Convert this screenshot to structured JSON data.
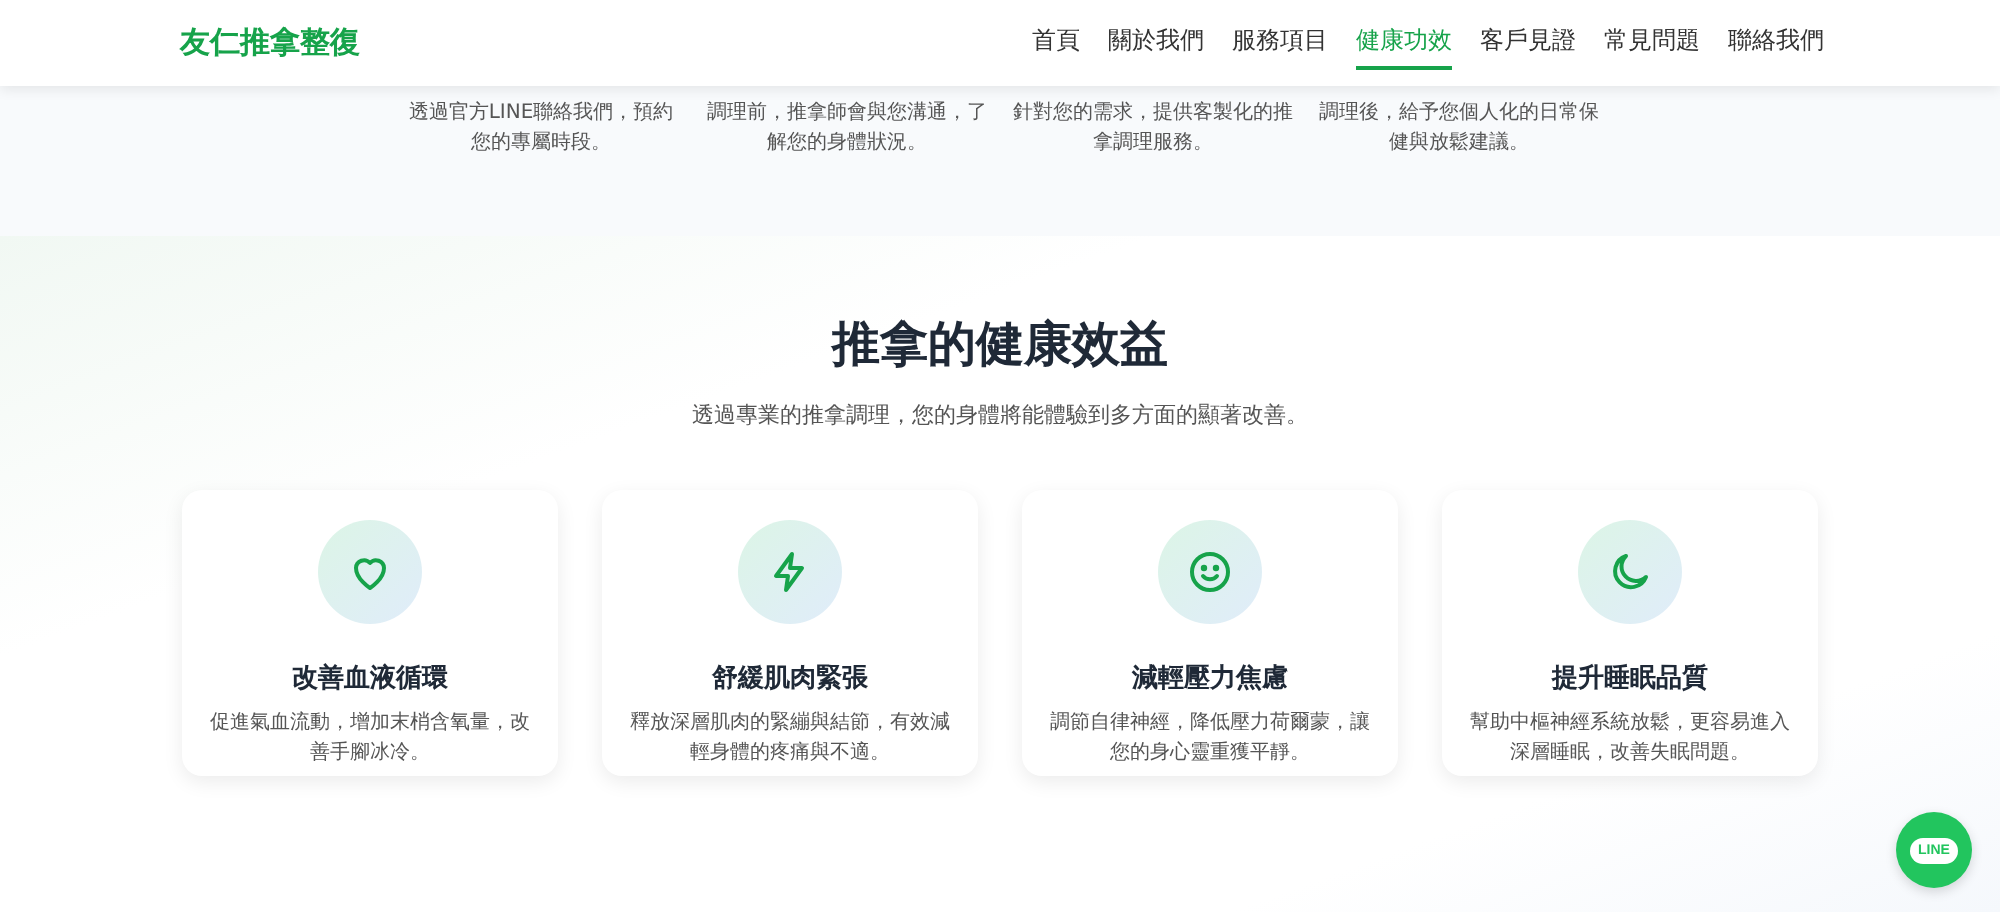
{
  "header": {
    "brand": "友仁推拿整復",
    "nav": [
      {
        "label": "首頁",
        "selected": false
      },
      {
        "label": "關於我們",
        "selected": false
      },
      {
        "label": "服務項目",
        "selected": false
      },
      {
        "label": "健康功效",
        "selected": true
      },
      {
        "label": "客戶見證",
        "selected": false
      },
      {
        "label": "常見問題",
        "selected": false
      },
      {
        "label": "聯絡我們",
        "selected": false
      }
    ]
  },
  "steps": [
    {
      "text": "透過官方LINE聯絡我們，預約您的專屬時段。"
    },
    {
      "text": "調理前，推拿師會與您溝通，了解您的身體狀況。"
    },
    {
      "text": "針對您的需求，提供客製化的推拿調理服務。"
    },
    {
      "text": "調理後，給予您個人化的日常保健與放鬆建議。"
    }
  ],
  "benefits": {
    "title": "推拿的健康效益",
    "subtitle": "透過專業的推拿調理，您的身體將能體驗到多方面的顯著改善。",
    "cards": [
      {
        "title": "改善血液循環",
        "text": "促進氣血流動，增加末梢含氧量，改善手腳冰冷。"
      },
      {
        "title": "舒緩肌肉緊張",
        "text": "釋放深層肌肉的緊繃與結節，有效減輕身體的疼痛與不適。"
      },
      {
        "title": "減輕壓力焦慮",
        "text": "調節自律神經，降低壓力荷爾蒙，讓您的身心靈重獲平靜。"
      },
      {
        "title": "提升睡眠品質",
        "text": "幫助中樞神經系統放鬆，更容易進入深層睡眠，改善失眠問題。"
      }
    ]
  },
  "line_button": {
    "label": "LINE"
  }
}
